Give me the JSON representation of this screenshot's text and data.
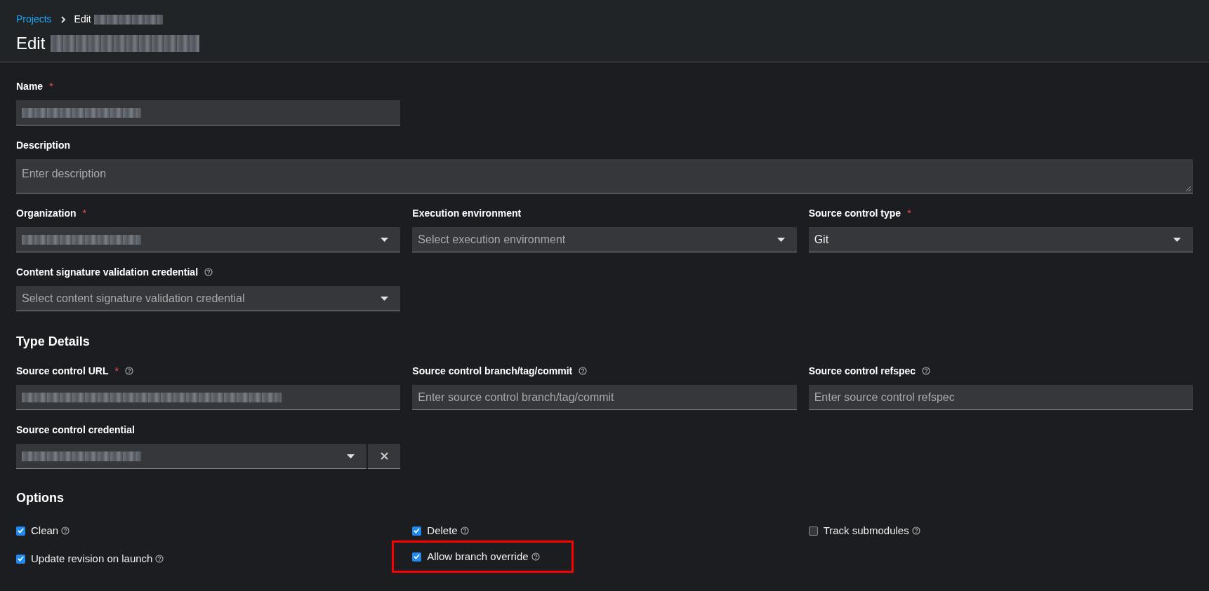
{
  "breadcrumb": {
    "link": "Projects",
    "current": "Edit",
    "current_redacted": true
  },
  "title": {
    "text": "Edit",
    "redacted": true
  },
  "sections": [
    {
      "rows": [
        [
          {
            "kind": "text",
            "label": "Name",
            "required_marker": "*",
            "help": false,
            "redacted": true
          }
        ],
        [
          {
            "kind": "textarea",
            "label": "Description",
            "help": false,
            "placeholder": "Enter description"
          }
        ],
        [
          {
            "kind": "select",
            "label": "Organization",
            "required_marker": "*",
            "help": false,
            "redacted": true
          },
          {
            "kind": "select",
            "label": "Execution environment",
            "help": false,
            "placeholder": "Select execution environment"
          },
          {
            "kind": "select",
            "label": "Source control type",
            "required_marker": "*",
            "help": false,
            "value": "Git"
          }
        ],
        [
          {
            "kind": "select",
            "label": "Content signature validation credential",
            "help": true,
            "placeholder": "Select content signature validation credential"
          }
        ]
      ]
    },
    {
      "heading": "Type Details",
      "rows": [
        [
          {
            "kind": "text",
            "label": "Source control URL",
            "required_marker": "*",
            "help": true,
            "redacted": true
          },
          {
            "kind": "text",
            "label": "Source control branch/tag/commit",
            "help": true,
            "placeholder": "Enter source control branch/tag/commit"
          },
          {
            "kind": "text",
            "label": "Source control refspec",
            "help": true,
            "placeholder": "Enter source control refspec"
          }
        ],
        [
          {
            "kind": "select",
            "label": "Source control credential",
            "help": false,
            "redacted": true,
            "clearable": true
          }
        ]
      ]
    }
  ],
  "options": {
    "heading": "Options",
    "rows": [
      [
        {
          "label": "Clean",
          "checked": true,
          "highlighted": false
        },
        {
          "label": "Delete",
          "checked": true,
          "highlighted": false
        },
        {
          "label": "Track submodules",
          "checked": false,
          "highlighted": false
        }
      ],
      [
        {
          "label": "Update revision on launch",
          "checked": true,
          "highlighted": false
        },
        {
          "label": "Allow branch override",
          "checked": true,
          "highlighted": true
        }
      ]
    ]
  }
}
